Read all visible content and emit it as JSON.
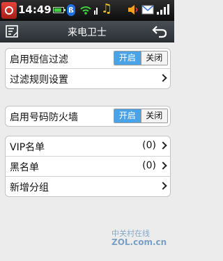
{
  "status_bar": {
    "time": "14:49",
    "icons": [
      "app-logo-icon",
      "battery-icon",
      "bluetooth-icon",
      "wifi-icon",
      "signal-icon",
      "music-icon",
      "volume-icon",
      "message-icon",
      "signal-bars-icon"
    ],
    "bluetooth_glyph": "ß"
  },
  "header": {
    "title": "来电卫士",
    "menu_icon": "menu-edit-icon",
    "back_icon": "back-arrow-icon"
  },
  "settings": {
    "sms_filter": {
      "label": "启用短信过滤",
      "on": "开启",
      "off": "关闭",
      "state": "on"
    },
    "filter_rules": {
      "label": "过滤规则设置"
    },
    "firewall": {
      "label": "启用号码防火墙",
      "on": "开启",
      "off": "关闭",
      "state": "on"
    }
  },
  "lists": [
    {
      "label": "VIP名单",
      "count": "(0)"
    },
    {
      "label": "黑名单",
      "count": "(0)"
    },
    {
      "label": "新增分组",
      "count": ""
    }
  ],
  "watermark": {
    "cn": "中关村在线",
    "url": "ZOL.com.cn"
  },
  "colors": {
    "toggle_on": "#4aa3e6",
    "titlebar": "#3a3f44",
    "statusbar": "#1a1a1a"
  }
}
